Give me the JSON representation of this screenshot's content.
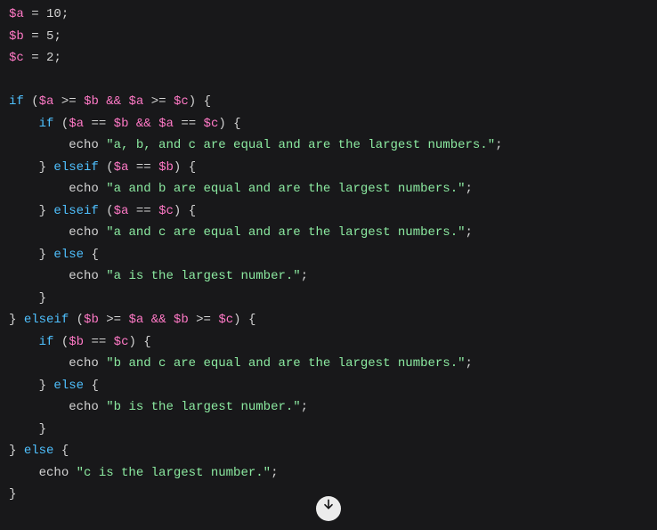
{
  "code": {
    "vars": {
      "a": "$a",
      "b": "$b",
      "c": "$c"
    },
    "vals": {
      "a": "10",
      "b": "5",
      "c": "2"
    },
    "kw": {
      "if": "if",
      "elseif": "elseif",
      "else": "else"
    },
    "fn": {
      "echo": "echo"
    },
    "op": {
      "assign": "=",
      "gte": ">=",
      "eq": "==",
      "and": "&&"
    },
    "str": {
      "abc_equal": "\"a, b, and c are equal and are the largest numbers.\"",
      "ab_equal": "\"a and b are equal and are the largest numbers.\"",
      "ac_equal": "\"a and c are equal and are the largest numbers.\"",
      "a_largest": "\"a is the largest number.\"",
      "bc_equal": "\"b and c are equal and are the largest numbers.\"",
      "b_largest": "\"b is the largest number.\"",
      "c_largest": "\"c is the largest number.\""
    }
  },
  "icons": {
    "scroll_down": "scroll-down"
  }
}
